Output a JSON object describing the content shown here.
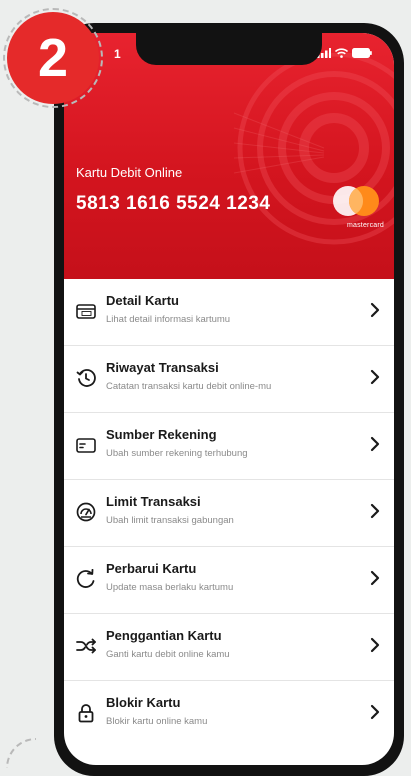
{
  "step": {
    "number": "2"
  },
  "status_bar": {
    "time": "1"
  },
  "card": {
    "label": "Kartu Debit Online",
    "number": "5813 1616 5524 1234",
    "network": "mastercard"
  },
  "menu": {
    "items": [
      {
        "title": "Detail Kartu",
        "subtitle": "Lihat detail informasi kartumu",
        "icon": "card-cvv-icon"
      },
      {
        "title": "Riwayat Transaksi",
        "subtitle": "Catatan transaksi kartu debit online-mu",
        "icon": "history-icon"
      },
      {
        "title": "Sumber Rekening",
        "subtitle": "Ubah sumber rekening terhubung",
        "icon": "account-card-icon"
      },
      {
        "title": "Limit Transaksi",
        "subtitle": "Ubah limit transaksi gabungan",
        "icon": "gauge-icon"
      },
      {
        "title": "Perbarui Kartu",
        "subtitle": "Update masa berlaku kartumu",
        "icon": "refresh-icon"
      },
      {
        "title": "Penggantian Kartu",
        "subtitle": "Ganti kartu debit online kamu",
        "icon": "shuffle-icon"
      },
      {
        "title": "Blokir Kartu",
        "subtitle": "Blokir kartu online kamu",
        "icon": "lock-icon"
      }
    ]
  },
  "colors": {
    "brand": "#e8232f",
    "badge": "#e52a2a"
  }
}
